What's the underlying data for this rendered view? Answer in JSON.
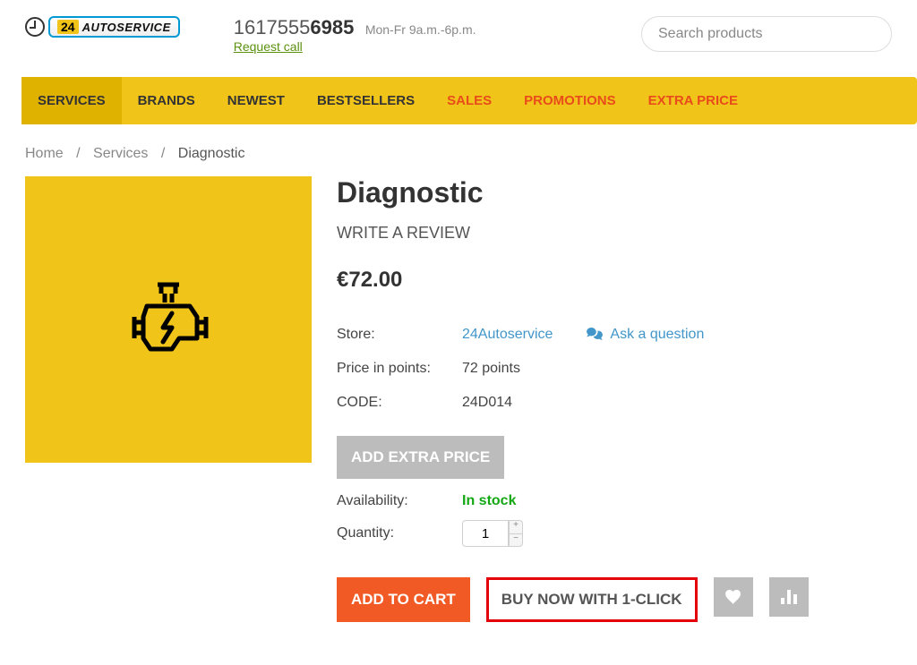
{
  "header": {
    "logo": {
      "number": "24",
      "text": "AUTOSERVICE"
    },
    "phone_prefix": "1617555",
    "phone_suffix": "6985",
    "hours": "Mon-Fr 9a.m.-6p.m.",
    "request_call": "Request call",
    "search_placeholder": "Search products"
  },
  "nav": {
    "items": [
      {
        "label": "SERVICES",
        "is_sale": false,
        "active": true
      },
      {
        "label": "BRANDS",
        "is_sale": false,
        "active": false
      },
      {
        "label": "NEWEST",
        "is_sale": false,
        "active": false
      },
      {
        "label": "BESTSELLERS",
        "is_sale": false,
        "active": false
      },
      {
        "label": "SALES",
        "is_sale": true,
        "active": false
      },
      {
        "label": "PROMOTIONS",
        "is_sale": true,
        "active": false
      },
      {
        "label": "EXTRA PRICE",
        "is_sale": true,
        "active": false
      }
    ]
  },
  "breadcrumb": {
    "home": "Home",
    "services": "Services",
    "current": "Diagnostic"
  },
  "product": {
    "title": "Diagnostic",
    "write_review": "WRITE A REVIEW",
    "price": "€72.00",
    "store_label": "Store:",
    "store_value": "24Autoservice",
    "ask_question": "Ask a question",
    "points_label": "Price in points:",
    "points_value": "72 points",
    "code_label": "CODE:",
    "code_value": "24D014",
    "extra_price_btn": "ADD EXTRA PRICE",
    "availability_label": "Availability:",
    "availability_value": "In stock",
    "quantity_label": "Quantity:",
    "quantity_value": "1",
    "add_to_cart": "ADD TO CART",
    "buy_now": "BUY NOW WITH 1-CLICK"
  }
}
